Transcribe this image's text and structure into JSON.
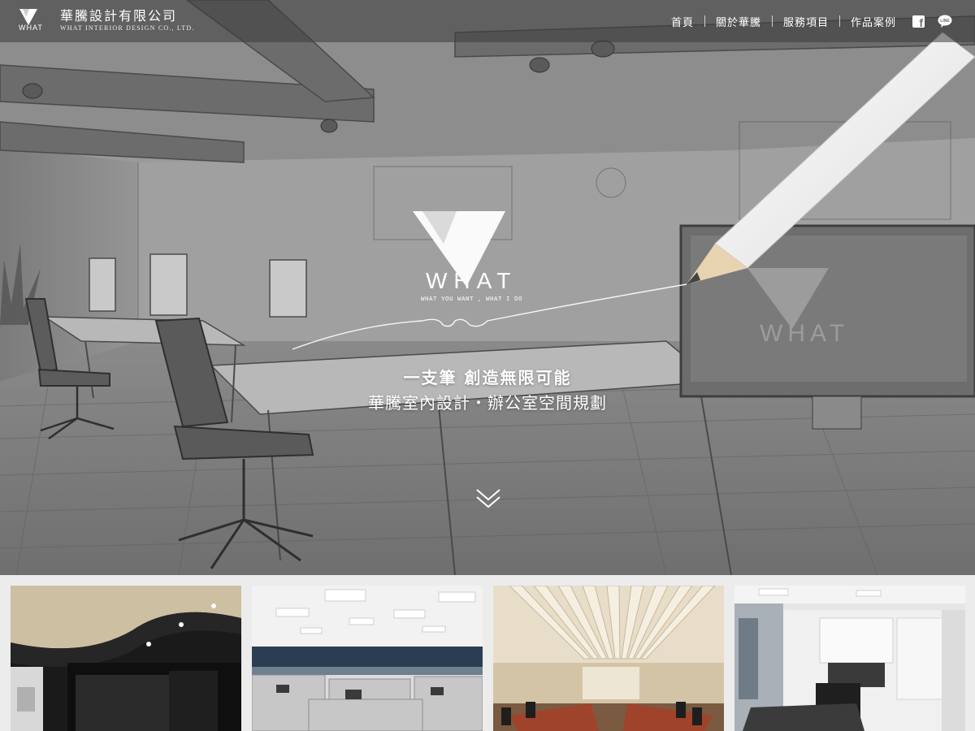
{
  "header": {
    "brand_name": "華騰設計有限公司",
    "brand_sub": "WHAT INTERIOR DESIGN CO., LTD.",
    "logo_word": "WHAT"
  },
  "nav": {
    "items": [
      {
        "label": "首頁"
      },
      {
        "label": "關於華騰"
      },
      {
        "label": "服務項目"
      },
      {
        "label": "作品案例"
      }
    ],
    "social": [
      {
        "icon": "facebook-icon"
      },
      {
        "icon": "line-icon",
        "label": "LINE"
      }
    ]
  },
  "hero": {
    "logo_word": "WHAT",
    "logo_tagline": "WHAT  YOU  WANT ,  WHAT  I  DO",
    "screen_logo_word": "WHAT",
    "tagline_1": "一支筆 創造無限可能",
    "tagline_2": "華騰室內設計・辦公室空間規劃",
    "scroll_icon": "chevron-double-down-icon"
  },
  "gallery": {
    "items": [
      {
        "name": "project-thumb-1"
      },
      {
        "name": "project-thumb-2"
      },
      {
        "name": "project-thumb-3"
      },
      {
        "name": "project-thumb-4"
      }
    ]
  },
  "colors": {
    "header_bg": "#3c3c3c",
    "text": "#ffffff",
    "page_bg": "#ececec"
  }
}
